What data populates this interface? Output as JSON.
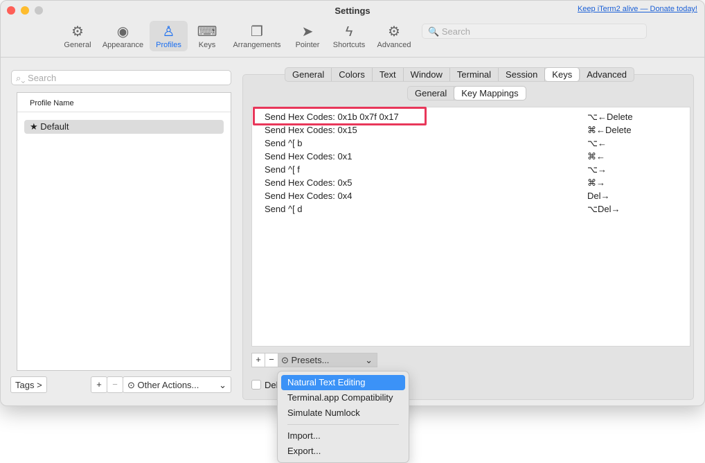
{
  "window": {
    "title": "Settings",
    "donate_link": "Keep iTerm2 alive — Donate today!"
  },
  "toolbar": {
    "items": [
      {
        "label": "General",
        "icon": "gear-icon",
        "glyph": "⚙"
      },
      {
        "label": "Appearance",
        "icon": "eye-icon",
        "glyph": "◉"
      },
      {
        "label": "Profiles",
        "icon": "person-icon",
        "glyph": "♙"
      },
      {
        "label": "Keys",
        "icon": "keyboard-icon",
        "glyph": "⌨"
      },
      {
        "label": "Arrangements",
        "icon": "windows-icon",
        "glyph": "❐"
      },
      {
        "label": "Pointer",
        "icon": "pointer-icon",
        "glyph": "➤"
      },
      {
        "label": "Shortcuts",
        "icon": "bolt-icon",
        "glyph": "ϟ"
      },
      {
        "label": "Advanced",
        "icon": "gears-icon",
        "glyph": "⚙"
      }
    ],
    "selected": "Profiles",
    "search_placeholder": "Search"
  },
  "profiles": {
    "search_placeholder": "Search",
    "column_header": "Profile Name",
    "items": [
      {
        "name": "Default",
        "starred": true
      }
    ],
    "tags_button": "Tags >",
    "add": "+",
    "remove": "−",
    "other_actions": "Other Actions..."
  },
  "tabs": {
    "items": [
      "General",
      "Colors",
      "Text",
      "Window",
      "Terminal",
      "Session",
      "Keys",
      "Advanced"
    ],
    "selected": "Keys"
  },
  "subtabs": {
    "items": [
      "General",
      "Key Mappings"
    ],
    "selected": "Key Mappings"
  },
  "mappings": [
    {
      "action": "Send Hex Codes: 0x1b 0x7f 0x17",
      "key": "⌥←Delete"
    },
    {
      "action": "Send Hex Codes: 0x15",
      "key": "⌘←Delete"
    },
    {
      "action": "Send ^[ b",
      "key": "⌥←"
    },
    {
      "action": "Send Hex Codes: 0x1",
      "key": "⌘←"
    },
    {
      "action": "Send ^[ f",
      "key": "⌥→"
    },
    {
      "action": "Send Hex Codes: 0x5",
      "key": "⌘→"
    },
    {
      "action": "Send Hex Codes: 0x4",
      "key": "Del→"
    },
    {
      "action": "Send ^[ d",
      "key": "⌥Del→"
    }
  ],
  "mapping_controls": {
    "add": "+",
    "remove": "−",
    "presets": "Presets...",
    "checkbox_label": "Del"
  },
  "presets_menu": {
    "items": [
      "Natural Text Editing",
      "Terminal.app Compatibility",
      "Simulate Numlock"
    ],
    "items2": [
      "Import...",
      "Export..."
    ],
    "highlighted": "Natural Text Editing"
  },
  "colors": {
    "accent": "#3b92f7",
    "highlight_box": "#e8375a"
  }
}
